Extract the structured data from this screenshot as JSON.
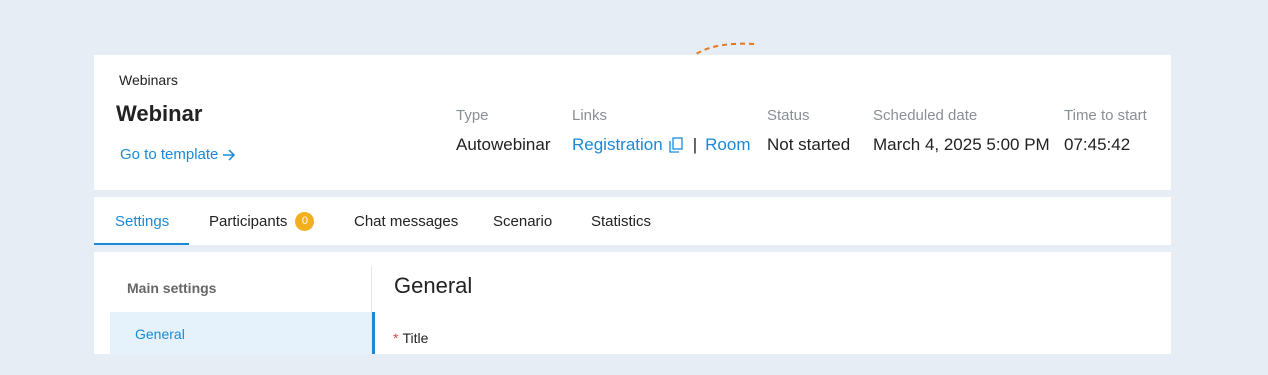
{
  "header": {
    "breadcrumb": "Webinars",
    "title": "Webinar",
    "template_link": "Go to template"
  },
  "info": {
    "type_label": "Type",
    "type_value": "Autowebinar",
    "links_label": "Links",
    "registration_link": "Registration",
    "separator": "|",
    "room_link": "Room",
    "status_label": "Status",
    "status_value": "Not started",
    "scheduled_label": "Scheduled date",
    "scheduled_value": "March 4, 2025 5:00 PM",
    "time_label": "Time to start",
    "time_value": "07:45:42"
  },
  "tabs": [
    {
      "label": "Settings",
      "active": true
    },
    {
      "label": "Participants",
      "badge": "0"
    },
    {
      "label": "Chat messages"
    },
    {
      "label": "Scenario"
    },
    {
      "label": "Statistics"
    }
  ],
  "sidebar": {
    "title": "Main settings",
    "items": [
      {
        "label": "General",
        "active": true
      }
    ]
  },
  "main": {
    "section_title": "General",
    "field_required_marker": "*",
    "field_label": "Title"
  },
  "colors": {
    "accent": "#1a8ad8",
    "badge": "#f2b01e",
    "annotation_arrow": "#e07a1f",
    "background": "#e6edf5"
  },
  "icons": [
    "arrow-right-icon",
    "copy-icon"
  ]
}
